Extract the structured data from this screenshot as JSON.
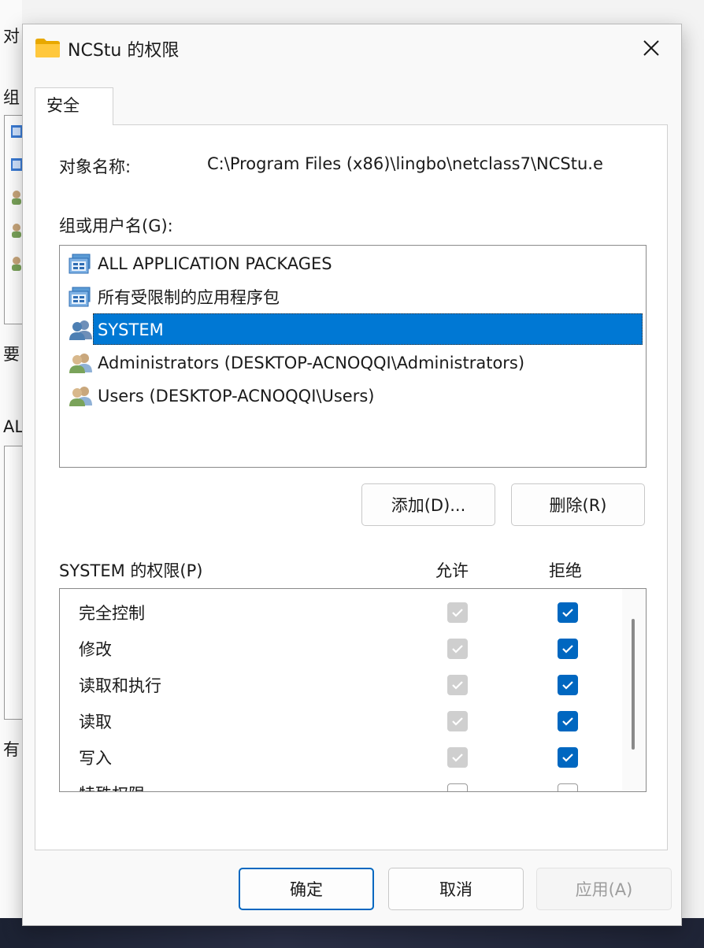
{
  "background": {
    "labels": [
      "对",
      "组",
      "要",
      "AL",
      "有"
    ]
  },
  "dialog": {
    "title": "NCStu 的权限",
    "tab_label": "安全",
    "object_name_label": "对象名称:",
    "object_name_value": "C:\\Program Files (x86)\\lingbo\\netclass7\\NCStu.e",
    "group_label": "组或用户名(G):",
    "users": [
      {
        "name": "ALL APPLICATION PACKAGES",
        "icon": "app-package-icon",
        "selected": false
      },
      {
        "name": "所有受限制的应用程序包",
        "icon": "app-package-icon",
        "selected": false
      },
      {
        "name": "SYSTEM",
        "icon": "users-group-icon",
        "selected": true
      },
      {
        "name": "Administrators (DESKTOP-ACNOQQI\\Administrators)",
        "icon": "users-group-icon",
        "selected": false
      },
      {
        "name": "Users (DESKTOP-ACNOQQI\\Users)",
        "icon": "users-group-icon",
        "selected": false
      }
    ],
    "add_button": "添加(D)...",
    "remove_button": "删除(R)",
    "permissions_label": "SYSTEM 的权限(P)",
    "allow_header": "允许",
    "deny_header": "拒绝",
    "permissions": [
      {
        "name": "完全控制",
        "allow": "checked-disabled",
        "deny": "checked"
      },
      {
        "name": "修改",
        "allow": "checked-disabled",
        "deny": "checked"
      },
      {
        "name": "读取和执行",
        "allow": "checked-disabled",
        "deny": "checked"
      },
      {
        "name": "读取",
        "allow": "checked-disabled",
        "deny": "checked"
      },
      {
        "name": "写入",
        "allow": "checked-disabled",
        "deny": "checked"
      },
      {
        "name": "特殊权限",
        "allow": "unchecked",
        "deny": "unchecked"
      }
    ],
    "ok_button": "确定",
    "cancel_button": "取消",
    "apply_button": "应用(A)"
  },
  "colors": {
    "accent": "#0078d4",
    "checkbox_checked": "#0067c0",
    "checkbox_disabled": "#cfcfcf"
  }
}
